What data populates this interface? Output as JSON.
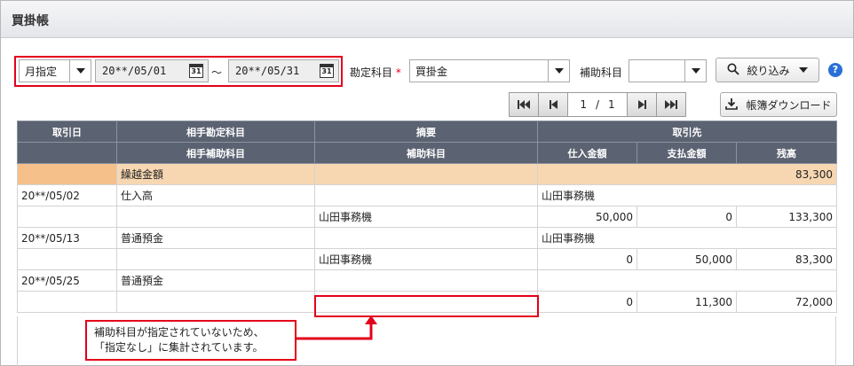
{
  "window": {
    "title": "買掛帳"
  },
  "filters": {
    "period_type": "月指定",
    "date_from": "20**/05/01",
    "date_to": "20**/05/31",
    "range_sep": "～",
    "calendar_glyph": "31",
    "account_label": "勘定科目",
    "required_mark": "*",
    "account_value": "買掛金",
    "sub_account_label": "補助科目",
    "sub_account_value": "",
    "filter_button": "絞り込み",
    "help": "?"
  },
  "pager": {
    "current": "1",
    "sep": "/",
    "total": "1"
  },
  "download_button": "帳簿ダウンロード",
  "table": {
    "header_row1": [
      "取引日",
      "相手勘定科目",
      "摘要",
      "取引先"
    ],
    "header_row2": [
      "相手補助科目",
      "補助科目",
      "仕入金額",
      "支払金額",
      "残高"
    ],
    "carry": {
      "label": "繰越金額",
      "balance": "83,300"
    },
    "entries": [
      {
        "date": "20**/05/02",
        "account": "仕入高",
        "partner": "山田事務機",
        "sub_account": "山田事務機",
        "purchase": "50,000",
        "payment": "0",
        "balance": "133,300"
      },
      {
        "date": "20**/05/13",
        "account": "普通預金",
        "partner": "山田事務機",
        "sub_account": "山田事務機",
        "purchase": "0",
        "payment": "50,000",
        "balance": "83,300"
      },
      {
        "date": "20**/05/25",
        "account": "普通預金",
        "partner": "",
        "sub_account": "",
        "purchase": "0",
        "payment": "11,300",
        "balance": "72,000"
      }
    ]
  },
  "annotation": {
    "line1": "補助科目が指定されていないため、",
    "line2": "「指定なし」に集計されています。"
  },
  "colors": {
    "highlight": "#e3001b",
    "header": "#5b6271",
    "carry": "#f7d7b2"
  }
}
